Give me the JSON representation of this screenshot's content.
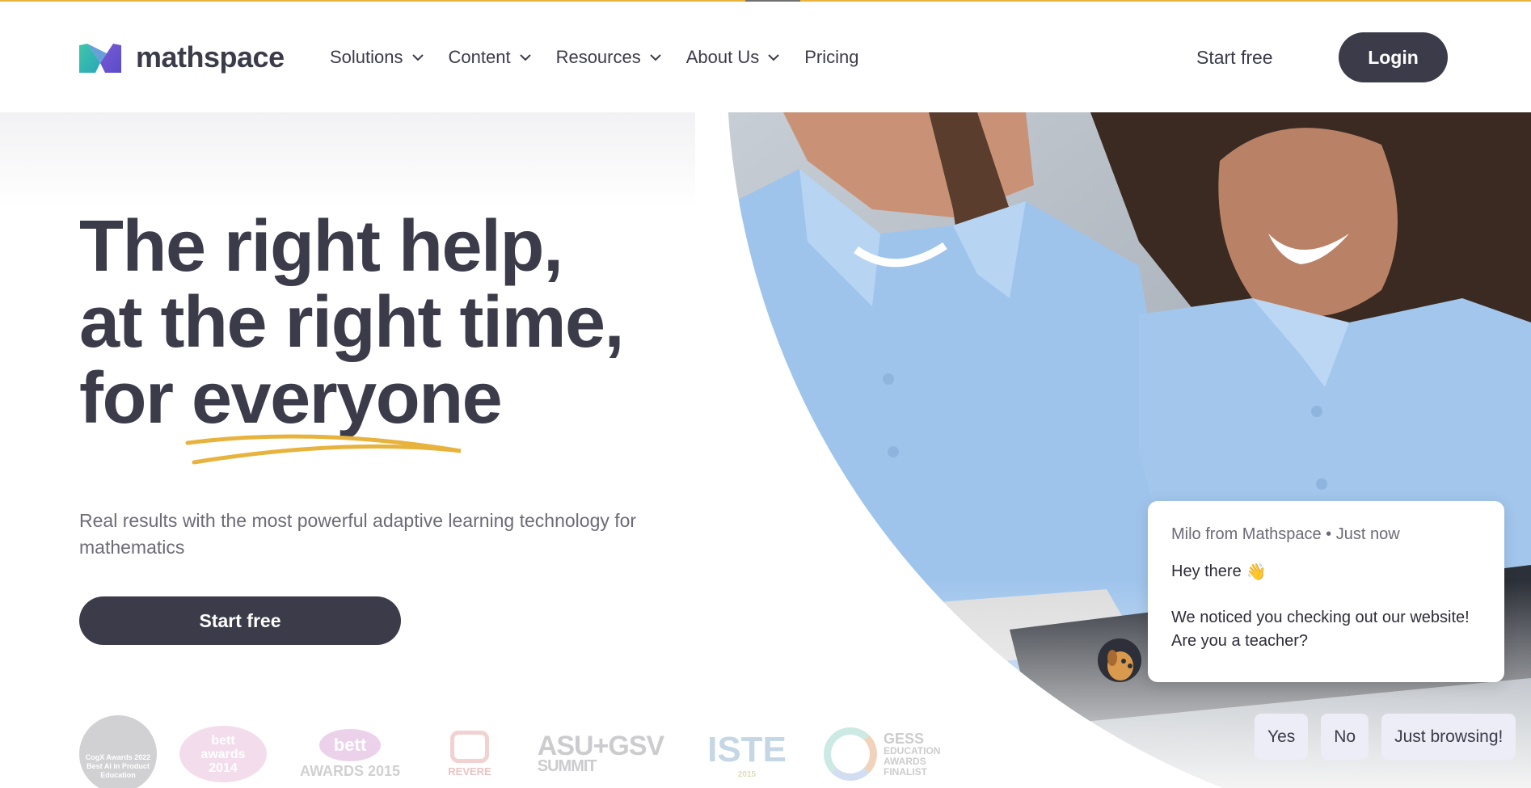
{
  "brand": {
    "name": "mathspace"
  },
  "nav": {
    "items": [
      {
        "label": "Solutions",
        "has_dropdown": true
      },
      {
        "label": "Content",
        "has_dropdown": true
      },
      {
        "label": "Resources",
        "has_dropdown": true
      },
      {
        "label": "About Us",
        "has_dropdown": true
      },
      {
        "label": "Pricing",
        "has_dropdown": false
      }
    ],
    "start_free": "Start free",
    "login": "Login"
  },
  "hero": {
    "line1": "The right help,",
    "line2": "at the right time,",
    "line3": "for everyone",
    "subtitle": "Real results with the most powerful adaptive learning technology for mathematics",
    "cta": "Start free"
  },
  "awards": {
    "cogx": {
      "name": "CogX Awards 2022",
      "detail": "Best AI in Product",
      "category": "Education"
    },
    "bett2014": {
      "name": "bett",
      "detail": "awards",
      "year": "2014"
    },
    "bett2015": {
      "name": "bett",
      "detail": "AWARDS 2015"
    },
    "revere": {
      "name": "REVERE"
    },
    "asugsv": {
      "name": "ASU+GSV",
      "detail": "SUMMIT"
    },
    "iste": {
      "name": "ISTE",
      "year": "2015"
    },
    "gess": {
      "name": "GESS",
      "detail": "EDUCATION AWARDS FINALIST"
    }
  },
  "chat": {
    "meta": "Milo from Mathspace • Just now",
    "greeting": "Hey there",
    "greeting_emoji": "👋",
    "body": "We noticed you checking out our website! Are you a teacher?",
    "replies": [
      "Yes",
      "No",
      "Just browsing!"
    ]
  },
  "colors": {
    "primary": "#3c3b4a",
    "accent_yellow": "#e8b33d",
    "logo_teal": "#3ec7a8",
    "logo_purple": "#6a5ad1",
    "reply_bg": "#ecedf7"
  },
  "icons": [
    "logo-icon",
    "chevron-down-icon",
    "waving-hand-icon",
    "dog-avatar-icon"
  ]
}
